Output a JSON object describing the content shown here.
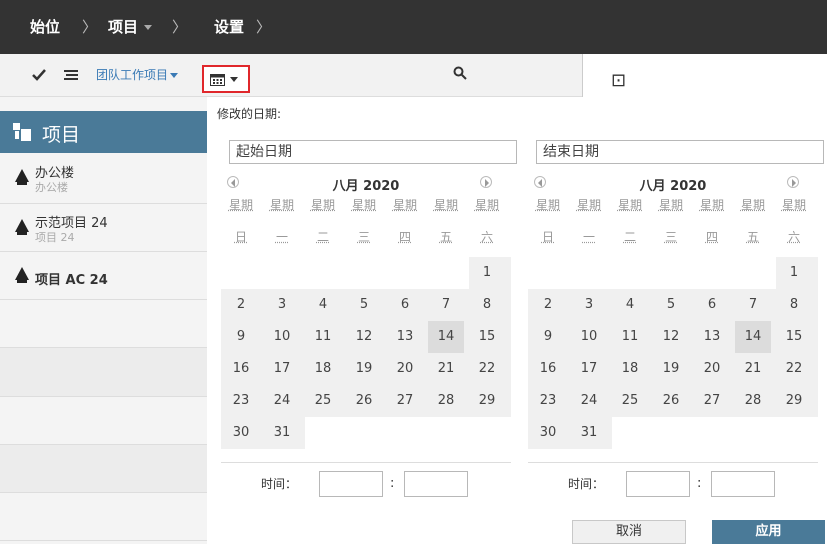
{
  "breadcrumb": {
    "home": "始位",
    "projects": "项目",
    "settings": "设置",
    "separator": "〉"
  },
  "toolbar": {
    "team_projects": "团队工作项目"
  },
  "sidebar": {
    "title": "项目",
    "items": [
      {
        "name": "办公楼",
        "sub": "办公楼"
      },
      {
        "name": "示范项目 24",
        "sub": "项目 24"
      },
      {
        "name": "项目 AC 24",
        "sub": ""
      }
    ]
  },
  "right_pane": {
    "glyph": "⊡"
  },
  "date_filter": {
    "title": "修改的日期:",
    "start_placeholder": "起始日期",
    "end_placeholder": "结束日期",
    "month_label": "八月 2020",
    "weekday_top": [
      "星期",
      "星期",
      "星期",
      "星期",
      "星期",
      "星期",
      "星期"
    ],
    "weekday_bottom": [
      "日",
      "一",
      "二",
      "三",
      "四",
      "五",
      "六"
    ],
    "weeks": [
      [
        "",
        "",
        "",
        "",
        "",
        "",
        "1"
      ],
      [
        "2",
        "3",
        "4",
        "5",
        "6",
        "7",
        "8"
      ],
      [
        "9",
        "10",
        "11",
        "12",
        "13",
        "14",
        "15"
      ],
      [
        "16",
        "17",
        "18",
        "19",
        "20",
        "21",
        "22"
      ],
      [
        "23",
        "24",
        "25",
        "26",
        "27",
        "28",
        "29"
      ],
      [
        "30",
        "31",
        "",
        "",
        "",
        "",
        ""
      ]
    ],
    "highlighted_day": "14",
    "time_label": "时间：",
    "time_separator": ":",
    "cancel": "取消",
    "apply": "应用"
  },
  "colors": {
    "topbar": "#333333",
    "accent": "#4a7a98",
    "highlight_border": "#e0272b"
  }
}
